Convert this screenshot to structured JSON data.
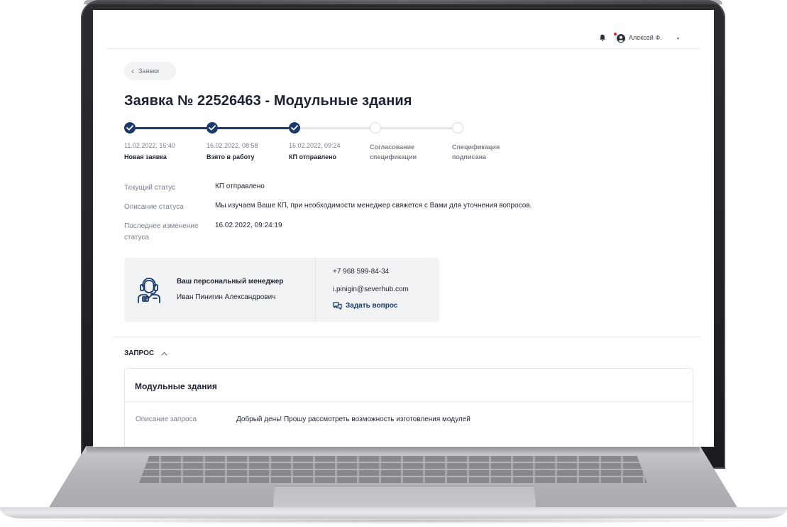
{
  "header": {
    "user_name": "Алексей Ф.",
    "caret": "▾"
  },
  "back_button": {
    "label": "Заявки",
    "arrow": "‹"
  },
  "page_title": "Заявка № 22526463 - Модульные здания",
  "stepper": {
    "completed_steps": 3,
    "accent_color": "#1a3a6b",
    "steps": [
      {
        "date": "11.02.2022, 16:40",
        "label": "Новая заявка",
        "done": true
      },
      {
        "date": "16.02.2022, 08:58",
        "label": "Взято в работу",
        "done": true
      },
      {
        "date": "16.02.2022, 09:24",
        "label": "КП отправлено",
        "done": true
      },
      {
        "date": "",
        "label_line1": "Согласование",
        "label_line2": "спецификации",
        "done": false
      },
      {
        "date": "",
        "label_line1": "Спецификация",
        "label_line2": "подписана",
        "done": false
      }
    ]
  },
  "status": {
    "current_label": "Текущий статус",
    "current_value": "КП отправлено",
    "description_label": "Описание статуса",
    "description_value": "Мы изучаем Ваше КП, при необходимости менеджер свяжется с Вами для уточнения вопросов.",
    "last_change_label_line1": "Последнее изменение",
    "last_change_label_line2": "статуса",
    "last_change_value": "16.02.2022, 09:24:19"
  },
  "manager": {
    "title": "Ваш персональный менеджер",
    "name": "Иван Пинигин Александрович",
    "phone": "+7 968 599-84-34",
    "email": "i.pinigin@severhub.com",
    "ask_label": "Задать вопрос"
  },
  "request_section": {
    "heading": "ЗАПРОС",
    "card_title": "Модульные здания",
    "description_label": "Описание запроса",
    "description_value": "Добрый день! Прошу рассмотреть возможность изготовления модулей"
  },
  "colors": {
    "accent": "#1a3a6b",
    "notification_dot": "#e2242b",
    "muted_text": "#7a808b",
    "card_bg": "#f2f3f5"
  }
}
